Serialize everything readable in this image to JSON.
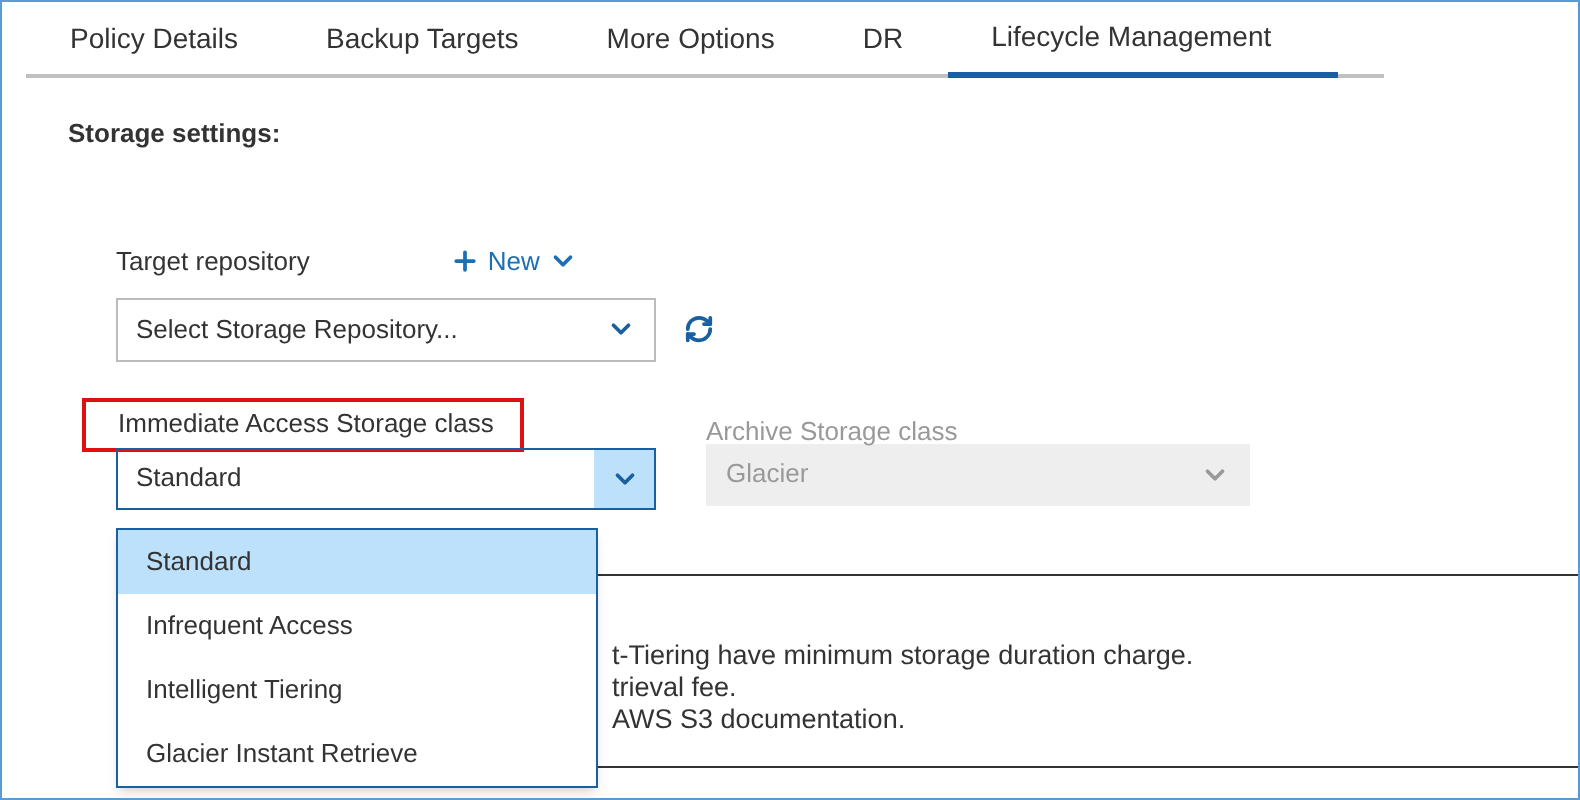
{
  "tabs": [
    {
      "label": "Policy Details",
      "selected": false
    },
    {
      "label": "Backup Targets",
      "selected": false
    },
    {
      "label": "More Options",
      "selected": false
    },
    {
      "label": "DR",
      "selected": false
    },
    {
      "label": "Lifecycle Management",
      "selected": true
    }
  ],
  "section_title": "Storage settings:",
  "target_repository": {
    "label": "Target repository",
    "new_label": "New",
    "placeholder": "Select Storage Repository..."
  },
  "immediate_class": {
    "label": "Immediate Access Storage class",
    "value": "Standard",
    "highlighted": true,
    "expanded": true,
    "options": [
      {
        "label": "Standard",
        "selected": true
      },
      {
        "label": "Infrequent Access",
        "selected": false
      },
      {
        "label": "Intelligent Tiering",
        "selected": false
      },
      {
        "label": "Glacier Instant Retrieve",
        "selected": false
      }
    ]
  },
  "archive_class": {
    "label": "Archive Storage class",
    "value": "Glacier",
    "disabled": true
  },
  "note_lines": [
    "t-Tiering have minimum storage duration charge.",
    "trieval fee.",
    "AWS S3 documentation."
  ]
}
